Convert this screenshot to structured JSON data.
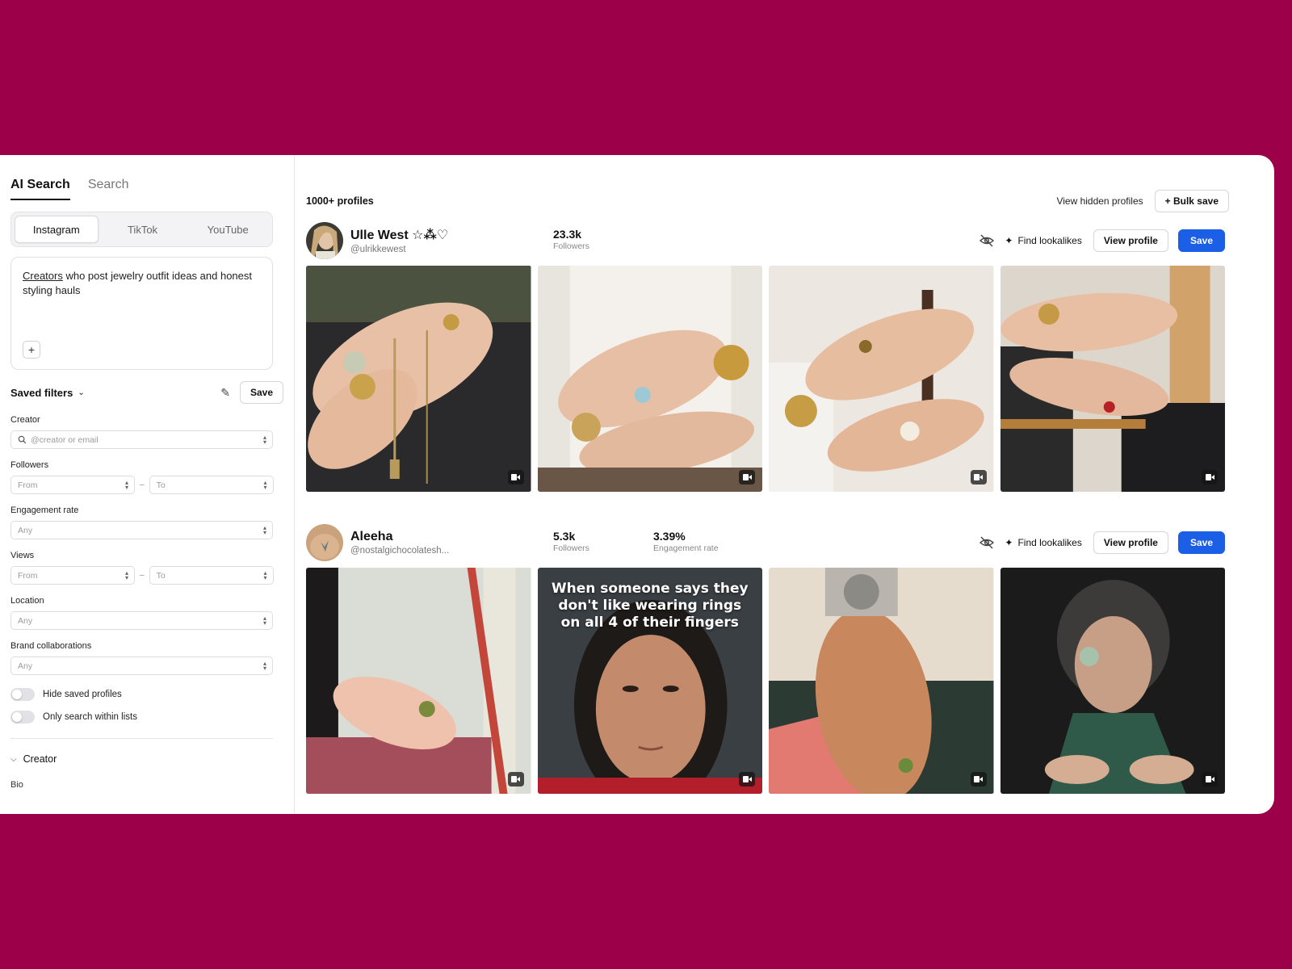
{
  "search_tabs": {
    "ai": "AI Search",
    "search": "Search"
  },
  "platforms": {
    "instagram": "Instagram",
    "tiktok": "TikTok",
    "youtube": "YouTube"
  },
  "prompt": {
    "underlined": "Creators",
    "rest": " who post jewelry outfit ideas and honest styling hauls",
    "add": "+"
  },
  "saved_filters": {
    "label": "Saved filters",
    "save": "Save"
  },
  "filters": {
    "creator": {
      "label": "Creator",
      "placeholder": "@creator or email"
    },
    "followers": {
      "label": "Followers",
      "from": "From",
      "to": "To"
    },
    "engagement": {
      "label": "Engagement rate",
      "value": "Any"
    },
    "views": {
      "label": "Views",
      "from": "From",
      "to": "To"
    },
    "location": {
      "label": "Location",
      "value": "Any"
    },
    "brand": {
      "label": "Brand collaborations",
      "value": "Any"
    },
    "range_dash": "–"
  },
  "toggles": {
    "hide_saved": "Hide saved profiles",
    "only_lists": "Only search within lists"
  },
  "section": {
    "creator": "Creator",
    "bio": "Bio"
  },
  "results": {
    "count": "1000+ profiles",
    "view_hidden": "View hidden profiles",
    "bulk_save": "+ Bulk save"
  },
  "profiles": [
    {
      "name": "Ulle West ☆⁂♡",
      "handle": "@ulrikkewest",
      "followers_value": "23.3k",
      "followers_label": "Followers",
      "find_lookalikes": "Find lookalikes",
      "view_profile": "View profile",
      "save": "Save"
    },
    {
      "name": "Aleeha",
      "handle": "@nostalgichocolatesh...",
      "followers_value": "5.3k",
      "followers_label": "Followers",
      "engagement_value": "3.39%",
      "engagement_label": "Engagement rate",
      "find_lookalikes": "Find lookalikes",
      "view_profile": "View profile",
      "save": "Save",
      "post_caption": "When someone says they don't like wearing  rings on all 4 of their fingers"
    }
  ],
  "colors": {
    "background": "#9c0048",
    "accent": "#1b5fe6"
  }
}
